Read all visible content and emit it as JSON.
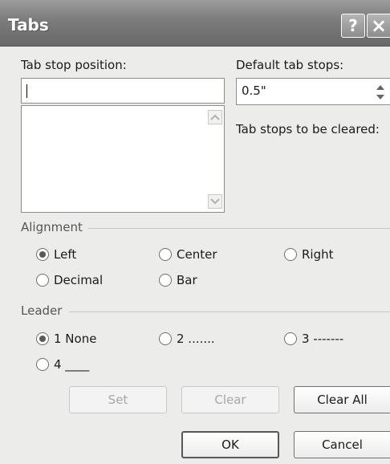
{
  "window": {
    "title": "Tabs",
    "help_glyph": "?",
    "close_glyph": "×"
  },
  "tab_stop_position": {
    "label": "Tab stop position:",
    "value": "",
    "list_items": []
  },
  "default_tab_stops": {
    "label": "Default tab stops:",
    "value": "0.5\""
  },
  "tab_stops_to_be_cleared": {
    "label": "Tab stops to be cleared:"
  },
  "alignment": {
    "group_label": "Alignment",
    "options": [
      {
        "label": "Left",
        "checked": true
      },
      {
        "label": "Center",
        "checked": false
      },
      {
        "label": "Right",
        "checked": false
      },
      {
        "label": "Decimal",
        "checked": false
      },
      {
        "label": "Bar",
        "checked": false
      }
    ]
  },
  "leader": {
    "group_label": "Leader",
    "options": [
      {
        "label": "1 None",
        "checked": true
      },
      {
        "label": "2 .......",
        "checked": false
      },
      {
        "label": "3 -------",
        "checked": false
      },
      {
        "label": "4 ____",
        "checked": false
      }
    ]
  },
  "buttons": {
    "set": "Set",
    "clear": "Clear",
    "clear_all": "Clear All",
    "ok": "OK",
    "cancel": "Cancel"
  },
  "colors": {
    "titlebar": "#7b7b7b",
    "dialog_bg": "#ececea",
    "disabled_text": "#a7a7a7"
  }
}
